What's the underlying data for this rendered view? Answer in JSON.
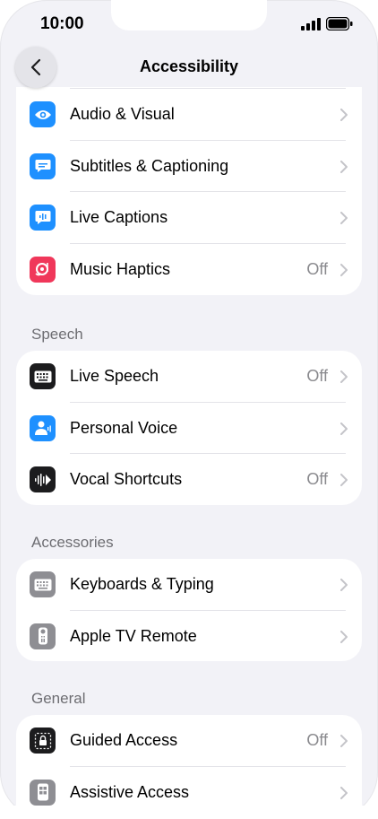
{
  "status_bar": {
    "time": "10:00"
  },
  "nav": {
    "title": "Accessibility",
    "back_icon": "chevron-left-icon"
  },
  "groups": [
    {
      "header": "",
      "items": [
        {
          "label": "Audio & Visual",
          "value": "",
          "icon": "audio-visual-icon",
          "color": "#1e90ff"
        },
        {
          "label": "Subtitles & Captioning",
          "value": "",
          "icon": "subtitles-icon",
          "color": "#1e90ff"
        },
        {
          "label": "Live Captions",
          "value": "",
          "icon": "live-captions-icon",
          "color": "#1e90ff"
        },
        {
          "label": "Music Haptics",
          "value": "Off",
          "icon": "music-haptics-icon",
          "color": "#f0375a"
        }
      ]
    },
    {
      "header": "Speech",
      "items": [
        {
          "label": "Live Speech",
          "value": "Off",
          "icon": "keyboard-icon",
          "color": "#1c1c1e"
        },
        {
          "label": "Personal Voice",
          "value": "",
          "icon": "personal-voice-icon",
          "color": "#1e90ff"
        },
        {
          "label": "Vocal Shortcuts",
          "value": "Off",
          "icon": "waveform-icon",
          "color": "#1c1c1e"
        }
      ]
    },
    {
      "header": "Accessories",
      "items": [
        {
          "label": "Keyboards & Typing",
          "value": "",
          "icon": "keyboard-icon",
          "color": "#8e8e93"
        },
        {
          "label": "Apple TV Remote",
          "value": "",
          "icon": "remote-icon",
          "color": "#8e8e93"
        }
      ]
    },
    {
      "header": "General",
      "items": [
        {
          "label": "Guided Access",
          "value": "Off",
          "icon": "lock-icon",
          "color": "#1c1c1e"
        },
        {
          "label": "Assistive Access",
          "value": "",
          "icon": "assistive-access-icon",
          "color": "#8e8e93"
        }
      ]
    }
  ]
}
